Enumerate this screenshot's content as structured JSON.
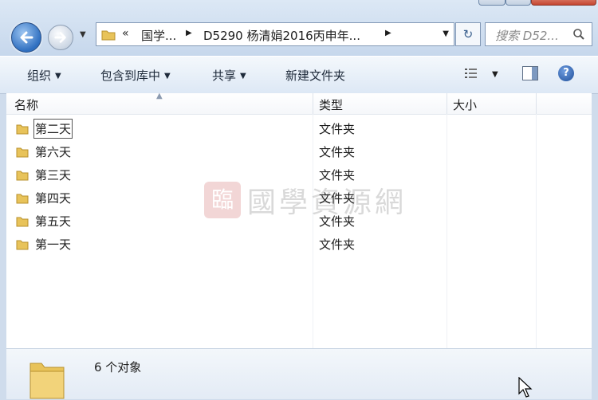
{
  "navigation": {
    "address_segments": [
      "国学...",
      "D5290 杨清娟2016丙申年..."
    ],
    "search_placeholder": "搜索 D52..."
  },
  "toolbar": {
    "items": [
      {
        "label": "组织",
        "has_dropdown": true
      },
      {
        "label": "包含到库中",
        "has_dropdown": true
      },
      {
        "label": "共享",
        "has_dropdown": true
      },
      {
        "label": "新建文件夹",
        "has_dropdown": false
      }
    ],
    "help_label": "?"
  },
  "columns": [
    "名称",
    "类型",
    "大小"
  ],
  "files": [
    {
      "name": "第二天",
      "type": "文件夹",
      "size": "",
      "focused": true
    },
    {
      "name": "第六天",
      "type": "文件夹",
      "size": ""
    },
    {
      "name": "第三天",
      "type": "文件夹",
      "size": ""
    },
    {
      "name": "第四天",
      "type": "文件夹",
      "size": ""
    },
    {
      "name": "第五天",
      "type": "文件夹",
      "size": ""
    },
    {
      "name": "第一天",
      "type": "文件夹",
      "size": ""
    }
  ],
  "watermark": {
    "text": "國學資源網",
    "seal": "臨"
  },
  "details": {
    "count_text": "6 个对象"
  },
  "colors": {
    "accent": "#2f6fc0",
    "folder": "#e8c35a",
    "chrome": "#cfdcec"
  },
  "icons": [
    "back-arrow-icon",
    "forward-arrow-icon",
    "folder-icon",
    "refresh-icon",
    "search-icon",
    "view-options-icon",
    "preview-pane-icon",
    "help-icon"
  ]
}
